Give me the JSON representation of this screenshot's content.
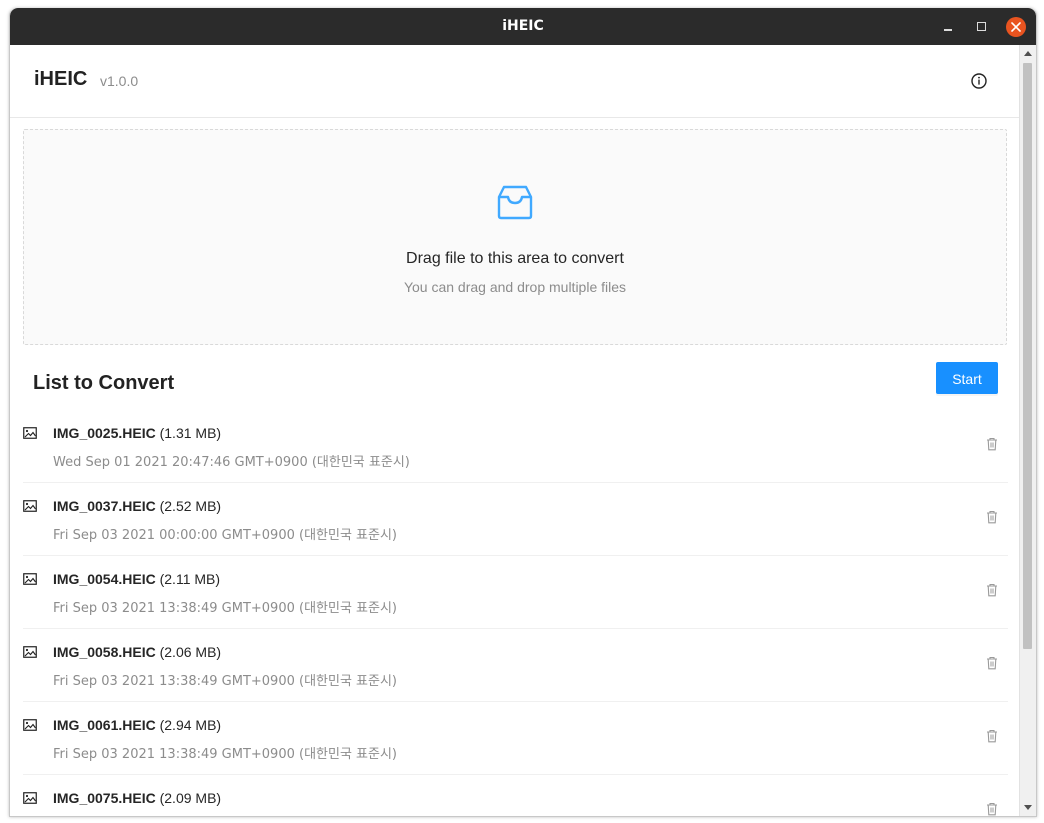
{
  "window": {
    "title": "iHEIC"
  },
  "header": {
    "app_name": "iHEIC",
    "version": "v1.0.0"
  },
  "dropzone": {
    "text": "Drag file to this area to convert",
    "hint": "You can drag and drop multiple files"
  },
  "list": {
    "title": "List to Convert",
    "start_label": "Start",
    "files": [
      {
        "name": "IMG_0025.HEIC",
        "size": "(1.31 MB)",
        "date": "Wed Sep 01 2021 20:47:46 GMT+0900 (대한민국 표준시)"
      },
      {
        "name": "IMG_0037.HEIC",
        "size": "(2.52 MB)",
        "date": "Fri Sep 03 2021 00:00:00 GMT+0900 (대한민국 표준시)"
      },
      {
        "name": "IMG_0054.HEIC",
        "size": "(2.11 MB)",
        "date": "Fri Sep 03 2021 13:38:49 GMT+0900 (대한민국 표준시)"
      },
      {
        "name": "IMG_0058.HEIC",
        "size": "(2.06 MB)",
        "date": "Fri Sep 03 2021 13:38:49 GMT+0900 (대한민국 표준시)"
      },
      {
        "name": "IMG_0061.HEIC",
        "size": "(2.94 MB)",
        "date": "Fri Sep 03 2021 13:38:49 GMT+0900 (대한민국 표준시)"
      },
      {
        "name": "IMG_0075.HEIC",
        "size": "(2.09 MB)",
        "date": ""
      }
    ]
  },
  "colors": {
    "accent": "#1890ff",
    "close_button": "#e95420",
    "titlebar": "#2b2b2b"
  },
  "icons": {
    "info": "info-circle-icon",
    "dropzone": "inbox-icon",
    "file": "image-icon",
    "delete": "trash-icon"
  }
}
